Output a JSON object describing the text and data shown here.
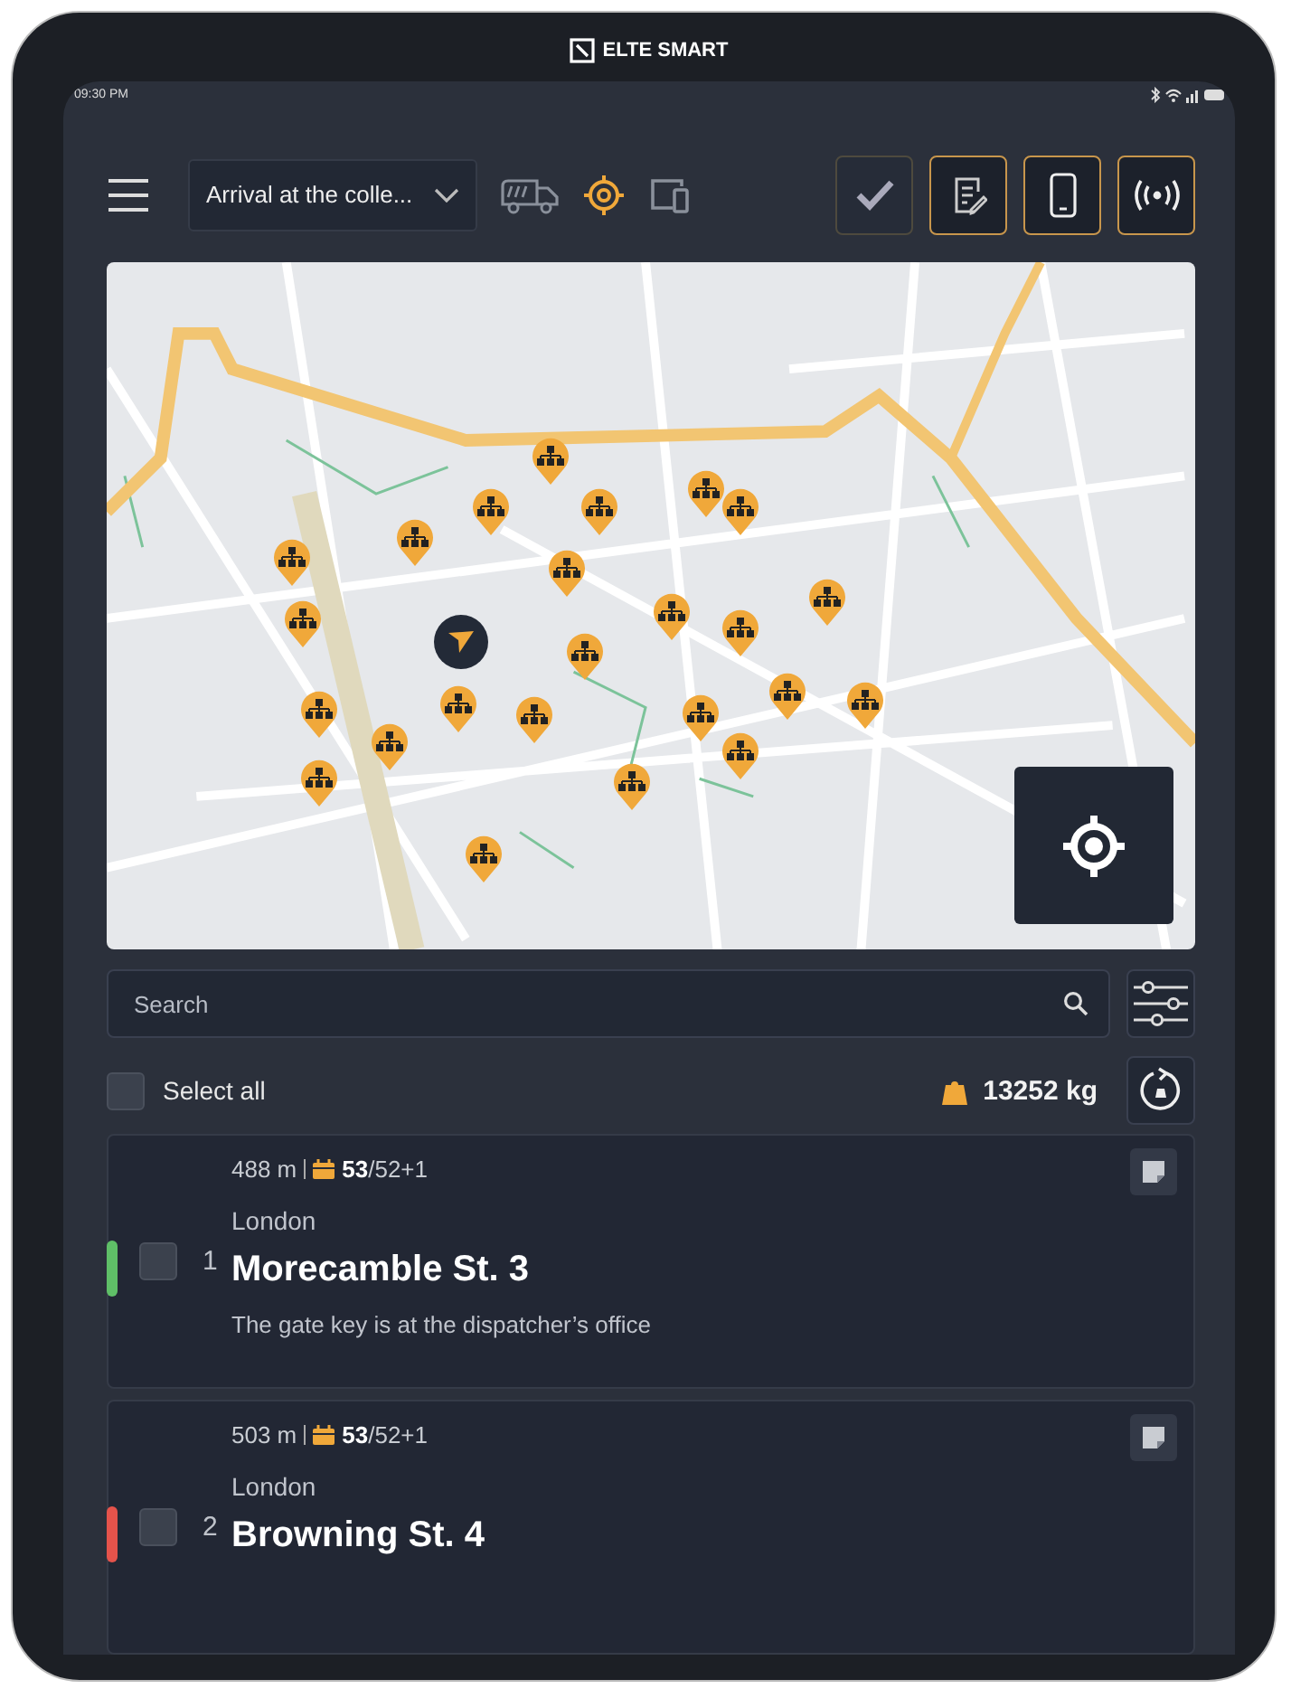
{
  "device": {
    "brand": "ELTE SMART"
  },
  "status_bar": {
    "time": "09:30 PM"
  },
  "toolbar": {
    "dropdown": {
      "value": "Arrival at the colle..."
    },
    "modes": [
      {
        "kind": "truck",
        "selected": false
      },
      {
        "kind": "target",
        "selected": true
      },
      {
        "kind": "devices",
        "selected": false
      }
    ],
    "actions": [
      {
        "kind": "check",
        "selected": false
      },
      {
        "kind": "note",
        "selected": true
      },
      {
        "kind": "phone",
        "selected": true
      },
      {
        "kind": "signal",
        "selected": true
      }
    ]
  },
  "search": {
    "placeholder": "Search"
  },
  "select_all": {
    "label": "Select all",
    "checked": false
  },
  "total_weight": "13252 kg",
  "stops": [
    {
      "color": "#5fbf67",
      "checked": false,
      "number": "1",
      "distance": "488 m",
      "count": "53",
      "count_total": "/52+1",
      "city": "London",
      "street": "Morecamble St. 3",
      "note": "The gate key is at the dispatcher’s office"
    },
    {
      "color": "#e5534b",
      "checked": false,
      "number": "2",
      "distance": "503 m",
      "count": "53",
      "count_total": "/52+1",
      "city": "London",
      "street": "Browning St. 4"
    }
  ]
}
